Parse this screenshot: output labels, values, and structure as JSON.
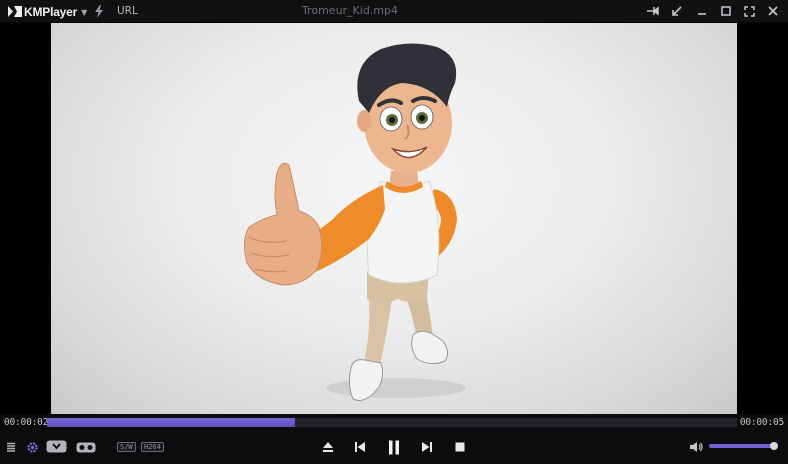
{
  "app": {
    "name": "KMPlayer",
    "url_label": "URL",
    "file_title": "Tromeur_Kid.mp4"
  },
  "icons": {
    "brand": "km-logo-icon",
    "menu_caret": "chevron-down-icon",
    "quick": "lightning-icon",
    "pin": "pin-icon",
    "mini": "shrink-arrow-icon",
    "minimize": "minimize-icon",
    "maximize": "maximize-icon",
    "fullscreen": "fullscreen-icon",
    "close": "close-icon",
    "playlist": "playlist-icon",
    "settings": "gear-icon",
    "capture": "capture-icon",
    "vr": "vr-glasses-icon",
    "eject": "eject-icon",
    "prev": "skip-previous-icon",
    "pause": "pause-icon",
    "next": "skip-next-icon",
    "stop": "stop-icon",
    "volume": "speaker-icon"
  },
  "playback": {
    "elapsed": "00:00:02",
    "total": "00:00:05",
    "progress_percent": 36
  },
  "badges": {
    "decoder": "S/W",
    "codec": "H264"
  },
  "volume": {
    "level_percent": 97
  },
  "colors": {
    "accent": "#6b5cd0",
    "background": "#0c0c0e",
    "settings_icon": "#7d6fe0"
  }
}
